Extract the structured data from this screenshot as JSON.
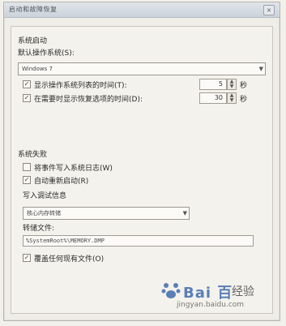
{
  "window": {
    "title": "启动和故障恢复",
    "close_label": "×"
  },
  "system_startup": {
    "section_title": "系统启动",
    "default_os_label": "默认操作系统(S):",
    "default_os_value": "Windows 7",
    "show_os_list": {
      "label": "显示操作系统列表的时间(T):",
      "checked": true,
      "value": "5",
      "unit": "秒"
    },
    "show_recovery": {
      "label": "在需要时显示恢复选项的时间(D):",
      "checked": true,
      "value": "30",
      "unit": "秒"
    }
  },
  "system_failure": {
    "section_title": "系统失败",
    "write_event": {
      "label": "将事件写入系统日志(W)",
      "checked": false
    },
    "auto_restart": {
      "label": "自动重新启动(R)",
      "checked": true
    },
    "debug_info_label": "写入调试信息",
    "debug_info_value": "核心内存转储",
    "dump_file_label": "转储文件:",
    "dump_file_value": "%SystemRoot%\\MEMORY.DMP",
    "overwrite": {
      "label": "覆盖任何现有文件(O)",
      "checked": true
    }
  },
  "watermark": {
    "brand": "Bai 百",
    "cn": "经验",
    "url": "jingyan.baidu.com"
  }
}
